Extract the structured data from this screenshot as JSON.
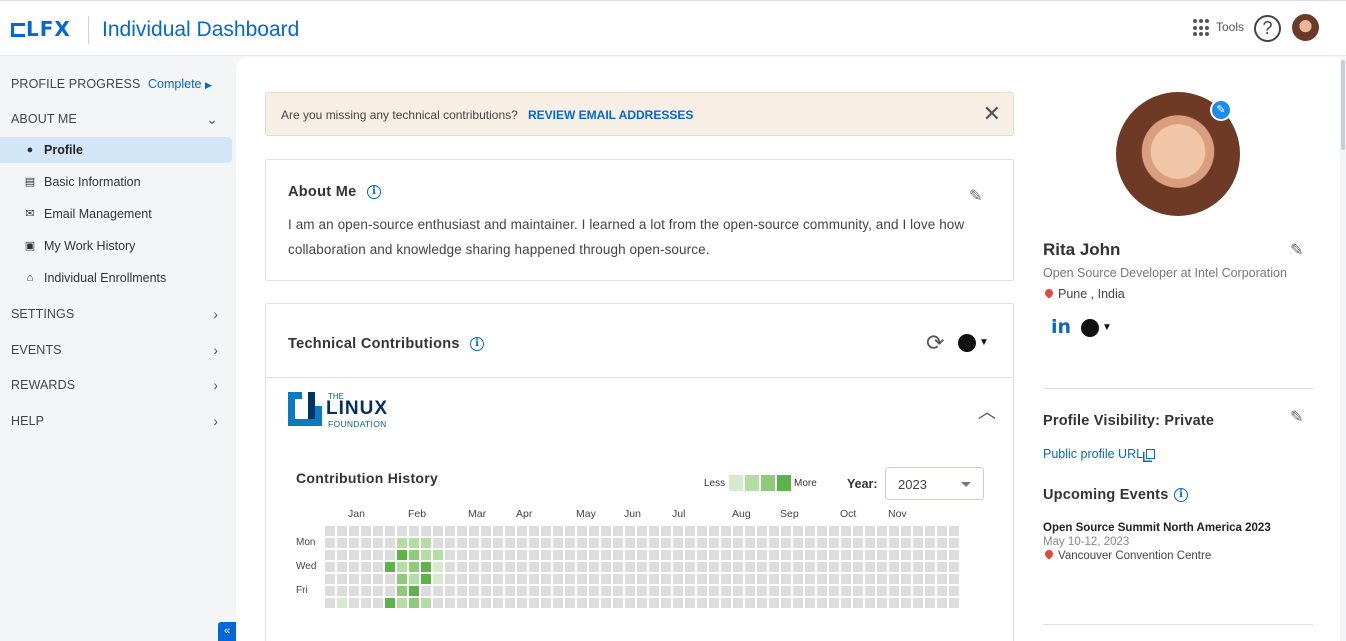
{
  "header": {
    "logo_text": "LFX",
    "app_title": "Individual Dashboard",
    "tools_label": "Tools",
    "help_glyph": "?"
  },
  "sidebar": {
    "profile_progress": {
      "label": "PROFILE PROGRESS",
      "status": "Complete"
    },
    "about_me": {
      "label": "ABOUT ME",
      "items": [
        {
          "label": "Profile",
          "icon": "person-icon",
          "active": true
        },
        {
          "label": "Basic Information",
          "icon": "id-card-icon"
        },
        {
          "label": "Email Management",
          "icon": "envelope-icon"
        },
        {
          "label": "My Work History",
          "icon": "briefcase-icon"
        },
        {
          "label": "Individual Enrollments",
          "icon": "enrollment-icon"
        }
      ]
    },
    "sections": [
      {
        "label": "SETTINGS"
      },
      {
        "label": "EVENTS"
      },
      {
        "label": "REWARDS"
      },
      {
        "label": "HELP"
      }
    ]
  },
  "alert": {
    "text": "Are you missing any technical contributions?",
    "link": "REVIEW EMAIL ADDRESSES"
  },
  "about": {
    "title": "About Me",
    "text": "I am an open-source enthusiast and maintainer. I learned a lot from the open-source community, and I love how collaboration and knowledge sharing happened through open-source."
  },
  "technical": {
    "title": "Technical Contributions",
    "org_logo": {
      "the": "THE",
      "name": "LINUX",
      "foundation": "FOUNDATION"
    },
    "history": {
      "title": "Contribution History",
      "legend_less": "Less",
      "legend_more": "More",
      "legend_colors": [
        "#d6ebce",
        "#b4dca4",
        "#8fca7b",
        "#5fb24a"
      ],
      "year_label": "Year:",
      "year_value": "2023",
      "months": [
        "Jan",
        "Feb",
        "Mar",
        "Apr",
        "May",
        "Jun",
        "Jul",
        "Aug",
        "Sep",
        "Oct",
        "Nov"
      ],
      "days": [
        "Mon",
        "Wed",
        "Fri"
      ],
      "empty_color": "#dcdcdc",
      "active_cells": [
        [
          1,
          6,
          1
        ],
        [
          5,
          3,
          4
        ],
        [
          5,
          6,
          4
        ],
        [
          6,
          1,
          2
        ],
        [
          6,
          2,
          4
        ],
        [
          6,
          3,
          2
        ],
        [
          6,
          4,
          3
        ],
        [
          6,
          5,
          3
        ],
        [
          6,
          6,
          2
        ],
        [
          6,
          7,
          2
        ],
        [
          7,
          1,
          2
        ],
        [
          7,
          2,
          3
        ],
        [
          7,
          3,
          3
        ],
        [
          7,
          4,
          2
        ],
        [
          7,
          5,
          4
        ],
        [
          7,
          6,
          3
        ],
        [
          7,
          7,
          2
        ],
        [
          8,
          1,
          2
        ],
        [
          8,
          2,
          2
        ],
        [
          8,
          3,
          4
        ],
        [
          8,
          4,
          4
        ],
        [
          8,
          6,
          2
        ],
        [
          9,
          2,
          2
        ],
        [
          9,
          3,
          1
        ],
        [
          9,
          4,
          1
        ]
      ]
    }
  },
  "profile": {
    "name": "Rita John",
    "title": "Open Source Developer at Intel Corporation",
    "location": "Pune , India",
    "linkedin_glyph": "in",
    "visibility": "Profile Visibility: Private",
    "public_url": "Public profile URL",
    "events_title": "Upcoming Events",
    "event": {
      "name": "Open Source Summit North America 2023",
      "date": "May 10-12, 2023",
      "location": "Vancouver Convention Centre"
    }
  }
}
